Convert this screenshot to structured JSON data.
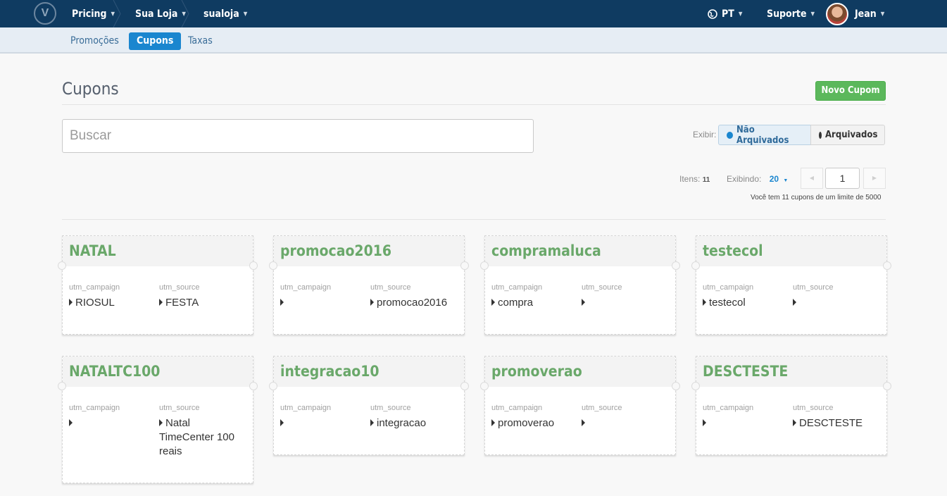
{
  "nav": {
    "logo": "V",
    "crumbs": [
      "Pricing",
      "Sua Loja",
      "sualoja"
    ],
    "language": "PT",
    "support": "Suporte",
    "user": "Jean"
  },
  "subnav": {
    "tabs": [
      "Promoções",
      "Cupons",
      "Taxas"
    ],
    "active": "Cupons"
  },
  "page": {
    "title": "Cupons",
    "new_button": "Novo Cupom",
    "search_placeholder": "Buscar",
    "filter_label": "Exibir:",
    "filter_not_archived": "Não Arquivados",
    "filter_archived": "Arquivados"
  },
  "pagination": {
    "items_label": "Itens:",
    "items_count": "11",
    "showing_label": "Exibindo:",
    "per_page": "20",
    "current_page": "1",
    "limit_text": "Você tem 11 cupons de um limite de 5000"
  },
  "coupons": [
    {
      "name": "NATAL",
      "campaign_label": "utm_campaign",
      "source_label": "utm_source",
      "campaign": "RIOSUL",
      "source": "FESTA"
    },
    {
      "name": "promocao2016",
      "campaign_label": "utm_campaign",
      "source_label": "utm_source",
      "campaign": "",
      "source": "promocao2016"
    },
    {
      "name": "compramaluca",
      "campaign_label": "utm_campaign",
      "source_label": "utm_source",
      "campaign": "compra",
      "source": ""
    },
    {
      "name": "testecol",
      "campaign_label": "utm_campaign",
      "source_label": "utm_source",
      "campaign": "testecol",
      "source": ""
    },
    {
      "name": "NATALTC100",
      "campaign_label": "utm_campaign",
      "source_label": "utm_source",
      "campaign": "",
      "source": "Natal TimeCenter 100 reais"
    },
    {
      "name": "integracao10",
      "campaign_label": "utm_campaign",
      "source_label": "utm_source",
      "campaign": "",
      "source": "integracao"
    },
    {
      "name": "promoverao",
      "campaign_label": "utm_campaign",
      "source_label": "utm_source",
      "campaign": "promoverao",
      "source": ""
    },
    {
      "name": "DESCTESTE",
      "campaign_label": "utm_campaign",
      "source_label": "utm_source",
      "campaign": "",
      "source": "DESCTESTE"
    }
  ],
  "colors": {
    "navbar": "#0f3b61",
    "accent": "#1a86cf",
    "coupon_title": "#6aa86a",
    "new_button": "#5cb85c"
  }
}
